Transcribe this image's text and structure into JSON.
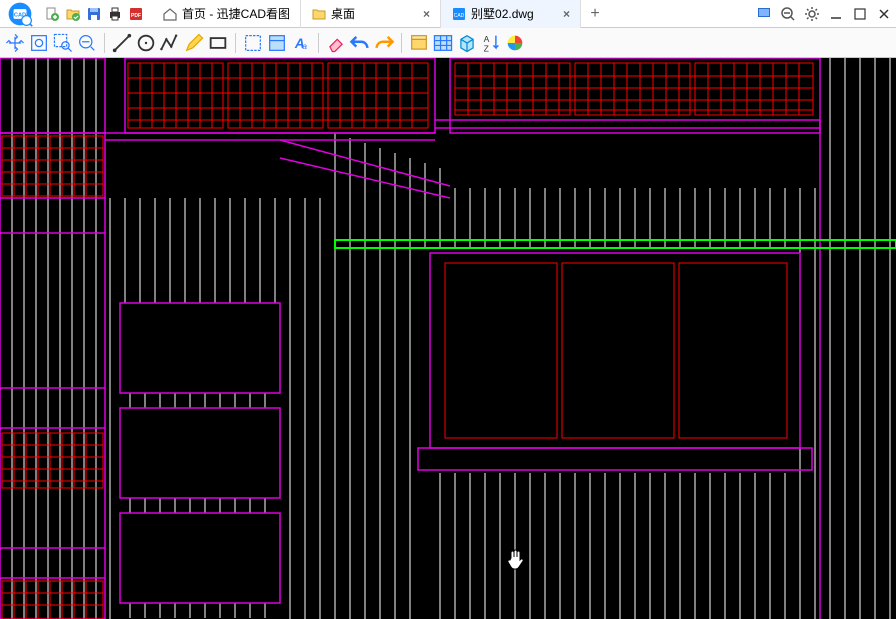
{
  "app": {
    "name": "迅捷CAD看图"
  },
  "tabs": [
    {
      "label": "首页 - 迅捷CAD看图",
      "active": false,
      "closeable": false,
      "icon": "home"
    },
    {
      "label": "桌面",
      "active": false,
      "closeable": true,
      "icon": "folder"
    },
    {
      "label": "别墅02.dwg",
      "active": true,
      "closeable": true,
      "icon": "cad"
    }
  ],
  "window_controls": [
    "fullscreen",
    "zoom-out",
    "settings",
    "minimize",
    "maximize",
    "close"
  ],
  "file_icons": [
    "new",
    "open",
    "save",
    "print",
    "pdf"
  ],
  "tools_row": [
    "pan",
    "zoom-extents",
    "zoom-window",
    "zoom-out",
    "sep",
    "line",
    "circle",
    "polyline",
    "edit",
    "rect",
    "sep",
    "layer",
    "properties",
    "text",
    "sep",
    "erase",
    "undo",
    "redo",
    "sep",
    "block",
    "table",
    "3d",
    "sort",
    "color-wheel"
  ],
  "colors": {
    "magenta": "#e000e0",
    "red": "#ff0000",
    "green": "#00ff00",
    "white": "#ffffff"
  }
}
